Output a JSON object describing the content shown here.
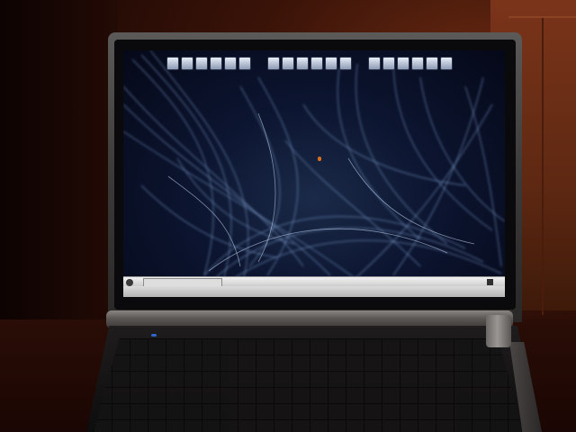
{
  "scene": {
    "description_colors": {
      "wall": "#5e2812",
      "room_dark": "#1a0704",
      "laptop_silver": "#5c5a58",
      "screen_bg": "#0c1530",
      "wallpaper_streak": "#8fb4e8",
      "power_led": "#2c66c8"
    }
  },
  "dock": {
    "icons": [
      "app-icon",
      "app-icon",
      "app-icon",
      "app-icon",
      "app-icon",
      "app-icon",
      "app-icon",
      "app-icon",
      "app-icon",
      "app-icon",
      "app-icon",
      "app-icon",
      "app-icon",
      "app-icon",
      "app-icon",
      "app-icon",
      "app-icon",
      "app-icon"
    ]
  }
}
